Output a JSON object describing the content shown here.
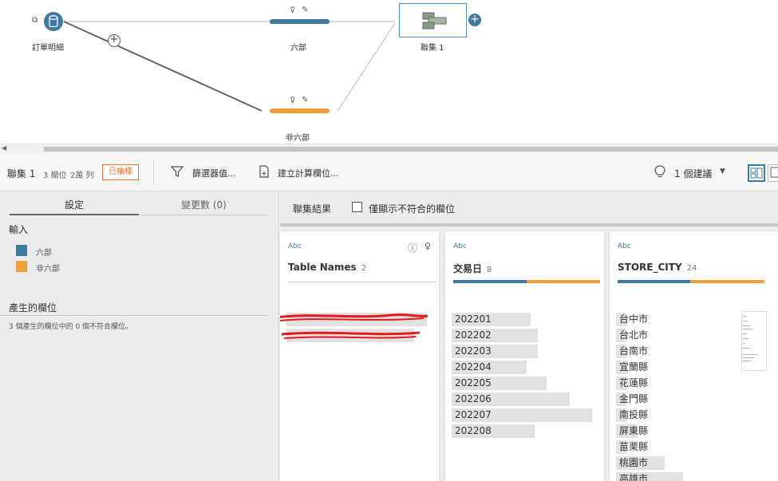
{
  "flow": {
    "source_label": "訂單明細",
    "step1_label": "六部",
    "step2_label": "非六部",
    "join_label": "聯集 1",
    "add_symbol": "+"
  },
  "toolbar": {
    "title": "聯集 1",
    "fields_count": "3 欄位",
    "rows_count": "2萬 列",
    "status_badge": "已抽樣",
    "filter_label": "篩選器值...",
    "calc_label": "建立計算欄位...",
    "suggestions_label": "1 個建議"
  },
  "left": {
    "tab_settings": "設定",
    "tab_changes": "變更數 (0)",
    "inputs_title": "輸入",
    "inputs": [
      {
        "label": "六部",
        "color": "#3d7aa3"
      },
      {
        "label": "非六部",
        "color": "#f29f3a"
      }
    ],
    "generated_title": "產生的欄位",
    "generated_desc": "3 個產生的欄位中的 0 個不符合欄位。"
  },
  "right": {
    "join_result_label": "聯集結果",
    "mismatch_label": "僅顯示不符合的欄位",
    "cards": [
      {
        "type_label": "Abc",
        "name": "Table Names",
        "count": "2",
        "values": [
          "",
          ""
        ],
        "value_fill": [
          0.95,
          0.85
        ],
        "split": [
          0.5,
          0.5
        ]
      },
      {
        "type_label": "Abc",
        "name": "交易日",
        "count": "8",
        "values": [
          "202201",
          "202202",
          "202203",
          "202204",
          "202205",
          "202206",
          "202207",
          "202208"
        ],
        "value_fill": [
          0.55,
          0.6,
          0.6,
          0.52,
          0.66,
          0.82,
          0.98,
          0.58
        ],
        "split": [
          0.5,
          0.5
        ]
      },
      {
        "type_label": "Abc",
        "name": "STORE_CITY",
        "count": "24",
        "values": [
          "台中市",
          "台北市",
          "台南市",
          "宜蘭縣",
          "花蓮縣",
          "金門縣",
          "南投縣",
          "屏東縣",
          "苗栗縣",
          "桃園市",
          "高雄市"
        ],
        "value_fill": [
          0.1,
          0.1,
          0.1,
          0.12,
          0.1,
          0.1,
          0.1,
          0.2,
          0.1,
          0.48,
          0.66
        ],
        "split": [
          0.45,
          0.55
        ]
      }
    ]
  },
  "colors": {
    "blue": "#3d7aa3",
    "orange": "#f29f3a",
    "accent_orange": "#e8732e"
  }
}
